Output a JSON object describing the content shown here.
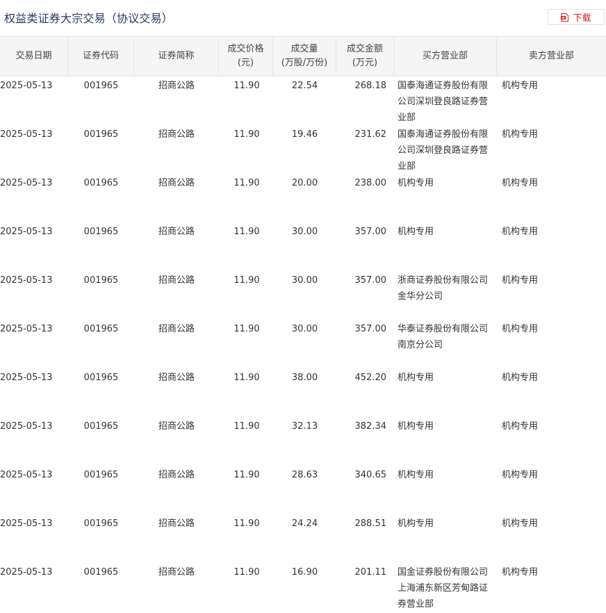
{
  "header": {
    "title": "权益类证券大宗交易（协议交易）",
    "download_label": "下载",
    "download_icon": "pdf-download-icon"
  },
  "table": {
    "columns": [
      {
        "key": "date",
        "label": "交易日期"
      },
      {
        "key": "code",
        "label": "证券代码"
      },
      {
        "key": "name",
        "label": "证券简称"
      },
      {
        "key": "price",
        "label": "成交价格（元）"
      },
      {
        "key": "vol",
        "label": "成交量（万股/万份）"
      },
      {
        "key": "amt",
        "label": "成交金额（万元）"
      },
      {
        "key": "buyer",
        "label": "买方营业部"
      },
      {
        "key": "seller",
        "label": "卖方营业部"
      }
    ],
    "header_lines": {
      "price": [
        "成交价格",
        "(元)"
      ],
      "vol": [
        "成交量",
        "(万股/万份)"
      ],
      "amt": [
        "成交金额",
        "(万元)"
      ]
    },
    "rows": [
      {
        "date": "2025-05-13",
        "code": "001965",
        "name": "招商公路",
        "price": "11.90",
        "vol": "22.54",
        "amt": "268.18",
        "buyer": "国泰海通证券股份有限公司深圳登良路证券营业部",
        "seller": "机构专用"
      },
      {
        "date": "2025-05-13",
        "code": "001965",
        "name": "招商公路",
        "price": "11.90",
        "vol": "19.46",
        "amt": "231.62",
        "buyer": "国泰海通证券股份有限公司深圳登良路证券营业部",
        "seller": "机构专用"
      },
      {
        "date": "2025-05-13",
        "code": "001965",
        "name": "招商公路",
        "price": "11.90",
        "vol": "20.00",
        "amt": "238.00",
        "buyer": "机构专用",
        "seller": "机构专用"
      },
      {
        "date": "2025-05-13",
        "code": "001965",
        "name": "招商公路",
        "price": "11.90",
        "vol": "30.00",
        "amt": "357.00",
        "buyer": "机构专用",
        "seller": "机构专用"
      },
      {
        "date": "2025-05-13",
        "code": "001965",
        "name": "招商公路",
        "price": "11.90",
        "vol": "30.00",
        "amt": "357.00",
        "buyer": "浙商证券股份有限公司金华分公司",
        "seller": "机构专用"
      },
      {
        "date": "2025-05-13",
        "code": "001965",
        "name": "招商公路",
        "price": "11.90",
        "vol": "30.00",
        "amt": "357.00",
        "buyer": "华泰证券股份有限公司南京分公司",
        "seller": "机构专用"
      },
      {
        "date": "2025-05-13",
        "code": "001965",
        "name": "招商公路",
        "price": "11.90",
        "vol": "38.00",
        "amt": "452.20",
        "buyer": "机构专用",
        "seller": "机构专用"
      },
      {
        "date": "2025-05-13",
        "code": "001965",
        "name": "招商公路",
        "price": "11.90",
        "vol": "32.13",
        "amt": "382.34",
        "buyer": "机构专用",
        "seller": "机构专用"
      },
      {
        "date": "2025-05-13",
        "code": "001965",
        "name": "招商公路",
        "price": "11.90",
        "vol": "28.63",
        "amt": "340.65",
        "buyer": "机构专用",
        "seller": "机构专用"
      },
      {
        "date": "2025-05-13",
        "code": "001965",
        "name": "招商公路",
        "price": "11.90",
        "vol": "24.24",
        "amt": "288.51",
        "buyer": "机构专用",
        "seller": "机构专用"
      },
      {
        "date": "2025-05-13",
        "code": "001965",
        "name": "招商公路",
        "price": "11.90",
        "vol": "16.90",
        "amt": "201.11",
        "buyer": "国金证券股份有限公司上海浦东新区芳甸路证券营业部",
        "seller": "机构专用"
      }
    ]
  },
  "colors": {
    "title": "#2a3a66",
    "header_bg": "#f5f5f5",
    "border": "#e6e6e6",
    "download_text": "#cc2222"
  }
}
